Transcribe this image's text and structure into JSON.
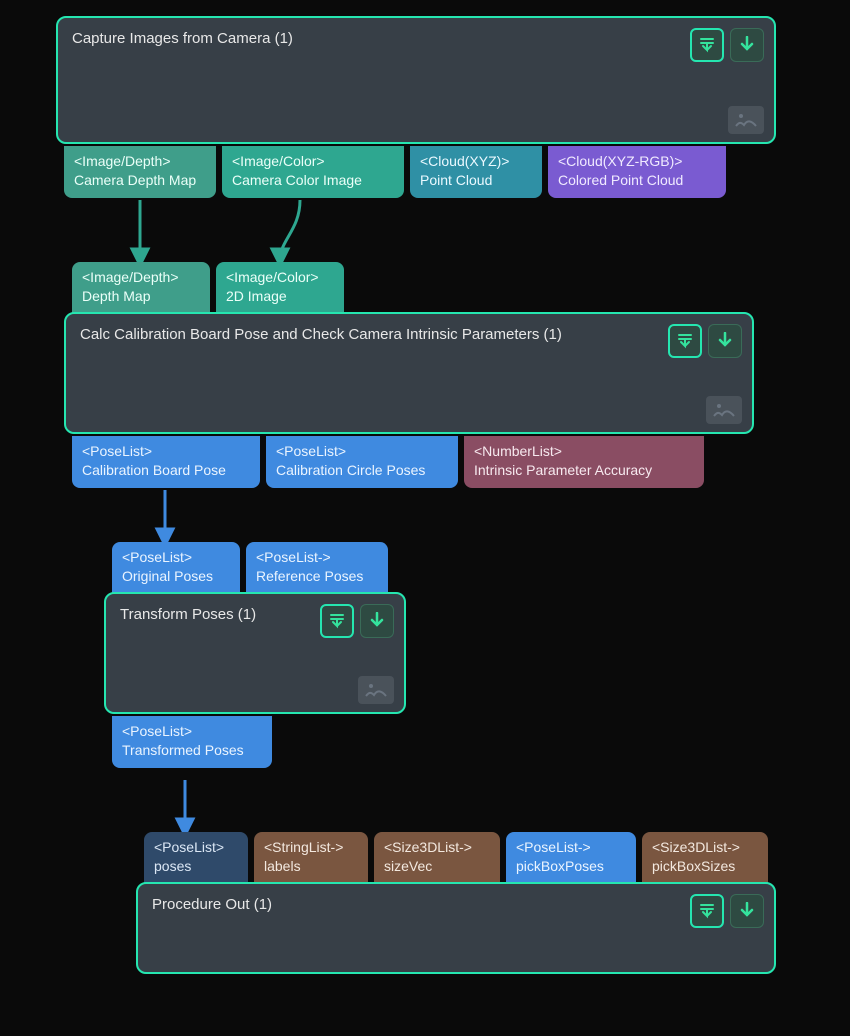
{
  "nodes": {
    "capture": {
      "title": "Capture Images from Camera (1)"
    },
    "calc": {
      "title": "Calc Calibration Board Pose and Check Camera Intrinsic Parameters (1)"
    },
    "transform": {
      "title": "Transform Poses (1)"
    },
    "procout": {
      "title": "Procedure Out (1)"
    }
  },
  "ports": {
    "capture_out": [
      {
        "type": "<Image/Depth>",
        "label": "Camera Depth Map"
      },
      {
        "type": "<Image/Color>",
        "label": "Camera Color Image"
      },
      {
        "type": "<Cloud(XYZ)>",
        "label": "Point Cloud"
      },
      {
        "type": "<Cloud(XYZ-RGB)>",
        "label": "Colored Point Cloud"
      }
    ],
    "calc_in": [
      {
        "type": "<Image/Depth>",
        "label": "Depth Map"
      },
      {
        "type": "<Image/Color>",
        "label": "2D Image"
      }
    ],
    "calc_out": [
      {
        "type": "<PoseList>",
        "label": "Calibration Board Pose"
      },
      {
        "type": "<PoseList>",
        "label": "Calibration Circle Poses"
      },
      {
        "type": "<NumberList>",
        "label": "Intrinsic Parameter Accuracy"
      }
    ],
    "transform_in": [
      {
        "type": "<PoseList>",
        "label": "Original Poses"
      },
      {
        "type": "<PoseList->",
        "label": "Reference Poses"
      }
    ],
    "transform_out": [
      {
        "type": "<PoseList>",
        "label": "Transformed Poses"
      }
    ],
    "procout_in": [
      {
        "type": "<PoseList>",
        "label": "poses"
      },
      {
        "type": "<StringList->",
        "label": "labels"
      },
      {
        "type": "<Size3DList->",
        "label": "sizeVec"
      },
      {
        "type": "<PoseList->",
        "label": "pickBoxPoses"
      },
      {
        "type": "<Size3DList->",
        "label": "pickBoxSizes"
      }
    ]
  }
}
